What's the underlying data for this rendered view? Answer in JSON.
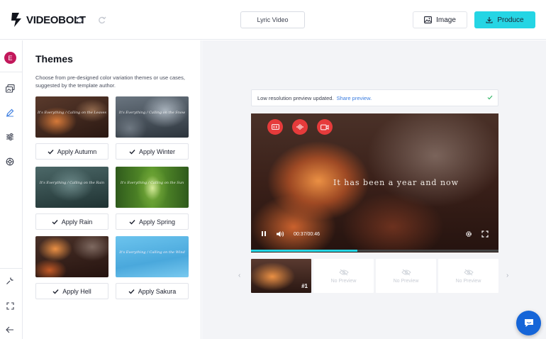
{
  "brand": {
    "name": "VIDEOBOLT"
  },
  "header": {
    "project_title": "Lyric Video",
    "image_label": "Image",
    "produce_label": "Produce"
  },
  "rail": {
    "avatar_letter": "E",
    "icons": [
      "scenes-icon",
      "edit-pen-icon",
      "sliders-icon",
      "settings-cog-icon",
      "wrench-icon",
      "fullscreen-icon",
      "collapse-arrow-icon"
    ]
  },
  "themes_panel": {
    "title": "Themes",
    "description": "Choose from pre-designed color variation themes or use cases, suggested by the template author.",
    "items": [
      {
        "label": "Apply Autumn",
        "caption": "It's Everything / Calling on the Leaves"
      },
      {
        "label": "Apply Winter",
        "caption": "It's Everything / Calling on the Snow"
      },
      {
        "label": "Apply Rain",
        "caption": "It's Everything / Calling on the Rain"
      },
      {
        "label": "Apply Spring",
        "caption": "It's Everything / Calling on the Sun"
      },
      {
        "label": "Apply Hell",
        "caption": ""
      },
      {
        "label": "Apply Sakura",
        "caption": "It's Everything / Calling on the Wind"
      }
    ]
  },
  "preview": {
    "notice_text": "Low resolution preview updated.",
    "notice_link": "Share preview.",
    "lyric_text": "It has been a year and now",
    "time": "00:37/00:46",
    "progress": 0.43
  },
  "filmstrip": {
    "active_label": "#1",
    "empty_label": "No Preview"
  },
  "colors": {
    "accent": "#25d5e4",
    "record": "#e63b3b",
    "chat": "#1565d8",
    "avatar": "#c2185b"
  }
}
